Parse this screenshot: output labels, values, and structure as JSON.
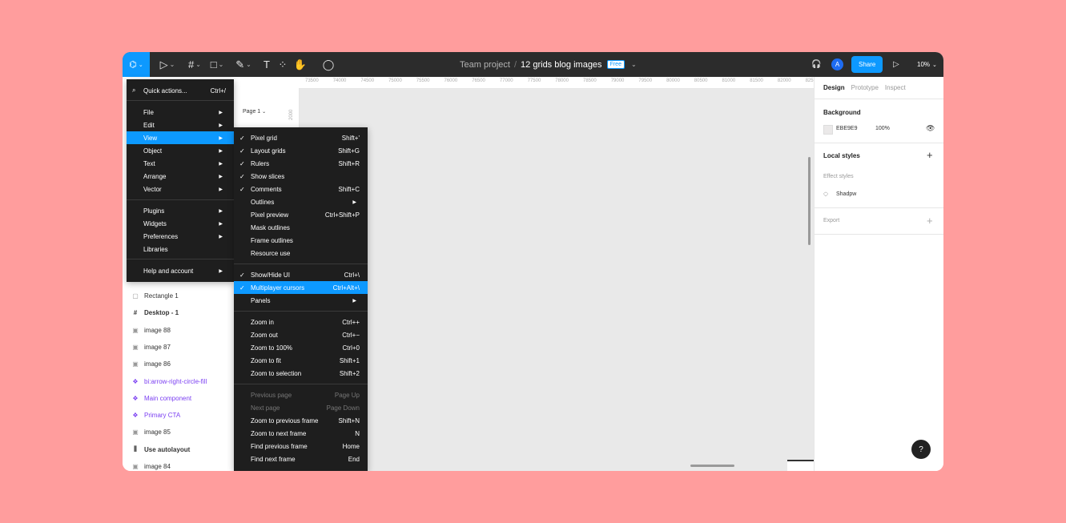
{
  "toolbar": {
    "logo_glyph": "⌬",
    "tools": [
      {
        "name": "move-tool-icon",
        "glyph": "▷"
      },
      {
        "name": "frame-tool-icon",
        "glyph": "#"
      },
      {
        "name": "shape-tool-icon",
        "glyph": "□"
      },
      {
        "name": "pen-tool-icon",
        "glyph": "✎"
      },
      {
        "name": "text-tool-icon",
        "glyph": "T"
      },
      {
        "name": "resources-icon",
        "glyph": "⁘"
      },
      {
        "name": "hand-tool-icon",
        "glyph": "✋"
      },
      {
        "name": "comment-tool-icon",
        "glyph": "◯"
      }
    ],
    "team": "Team project",
    "separator": "/",
    "file_name": "12 grids blog images",
    "badge": "Free",
    "avatar_letter": "A",
    "share_label": "Share",
    "zoom": "10%",
    "headphones_glyph": "🎧",
    "play_glyph": "▷"
  },
  "layers": {
    "page_label": "Page 1",
    "items": [
      {
        "label": "Rectangle 1",
        "kind": "rect",
        "icon": "▢"
      },
      {
        "label": "Desktop - 1",
        "kind": "frame",
        "icon": "#"
      },
      {
        "label": "image 88",
        "kind": "image",
        "icon": "▣"
      },
      {
        "label": "image 87",
        "kind": "image",
        "icon": "▣"
      },
      {
        "label": "image 86",
        "kind": "image",
        "icon": "▣"
      },
      {
        "label": "bi:arrow-right-circle-fill",
        "kind": "component",
        "icon": "❖"
      },
      {
        "label": "Main component",
        "kind": "component",
        "icon": "❖"
      },
      {
        "label": "Primary CTA",
        "kind": "component",
        "icon": "❖"
      },
      {
        "label": "image 85",
        "kind": "image",
        "icon": "▣"
      },
      {
        "label": "Use autolayout",
        "kind": "autolayout",
        "icon": "⫼"
      },
      {
        "label": "image 84",
        "kind": "image",
        "icon": "▣"
      }
    ]
  },
  "ruler": {
    "ticks": [
      "73500",
      "74000",
      "74500",
      "75000",
      "75500",
      "76000",
      "76500",
      "77000",
      "77500",
      "78000",
      "78500",
      "79000",
      "79500",
      "80000",
      "80500",
      "81000",
      "81500",
      "82000",
      "825"
    ],
    "left_ticks": [
      "2000",
      "1500"
    ]
  },
  "main_menu": {
    "quick_actions": "Quick actions...",
    "quick_actions_shortcut": "Ctrl+/",
    "items": [
      {
        "label": "File",
        "submenu": true
      },
      {
        "label": "Edit",
        "submenu": true
      },
      {
        "label": "View",
        "submenu": true,
        "selected": true
      },
      {
        "label": "Object",
        "submenu": true
      },
      {
        "label": "Text",
        "submenu": true
      },
      {
        "label": "Arrange",
        "submenu": true
      },
      {
        "label": "Vector",
        "submenu": true
      },
      {
        "label": "Plugins",
        "submenu": true
      },
      {
        "label": "Widgets",
        "submenu": true
      },
      {
        "label": "Preferences",
        "submenu": true
      },
      {
        "label": "Libraries",
        "submenu": false
      },
      {
        "label": "Help and account",
        "submenu": true
      }
    ]
  },
  "view_menu": {
    "items": [
      {
        "label": "Pixel grid",
        "shortcut": "Shift+'",
        "checked": true
      },
      {
        "label": "Layout grids",
        "shortcut": "Shift+G",
        "checked": true
      },
      {
        "label": "Rulers",
        "shortcut": "Shift+R",
        "checked": true
      },
      {
        "label": "Show slices",
        "shortcut": "",
        "checked": true
      },
      {
        "label": "Comments",
        "shortcut": "Shift+C",
        "checked": true
      },
      {
        "label": "Outlines",
        "shortcut": "",
        "submenu": true
      },
      {
        "label": "Pixel preview",
        "shortcut": "Ctrl+Shift+P"
      },
      {
        "label": "Mask outlines",
        "shortcut": ""
      },
      {
        "label": "Frame outlines",
        "shortcut": ""
      },
      {
        "label": "Resource use",
        "shortcut": ""
      },
      {
        "label": "Show/Hide UI",
        "shortcut": "Ctrl+\\",
        "checked": true
      },
      {
        "label": "Multiplayer cursors",
        "shortcut": "Ctrl+Alt+\\",
        "checked": true,
        "selected": true
      },
      {
        "label": "Panels",
        "shortcut": "",
        "submenu": true
      },
      {
        "label": "Zoom in",
        "shortcut": "Ctrl++"
      },
      {
        "label": "Zoom out",
        "shortcut": "Ctrl+−"
      },
      {
        "label": "Zoom to 100%",
        "shortcut": "Ctrl+0"
      },
      {
        "label": "Zoom to fit",
        "shortcut": "Shift+1"
      },
      {
        "label": "Zoom to selection",
        "shortcut": "Shift+2"
      },
      {
        "label": "Previous page",
        "shortcut": "Page Up",
        "disabled": true
      },
      {
        "label": "Next page",
        "shortcut": "Page Down",
        "disabled": true
      },
      {
        "label": "Zoom to previous frame",
        "shortcut": "Shift+N"
      },
      {
        "label": "Zoom to next frame",
        "shortcut": "N"
      },
      {
        "label": "Find previous frame",
        "shortcut": "Home"
      },
      {
        "label": "Find next frame",
        "shortcut": "End"
      }
    ]
  },
  "right_panel": {
    "tabs": [
      "Design",
      "Prototype",
      "Inspect"
    ],
    "background_label": "Background",
    "background_hex": "EBE9E9",
    "background_opacity": "100%",
    "local_styles_label": "Local styles",
    "effect_styles_label": "Effect styles",
    "effect_style_name": "Shadpw",
    "export_label": "Export",
    "help_glyph": "?"
  },
  "colors": {
    "accent": "#0d99ff",
    "toolbar_bg": "#2c2c2c",
    "menu_bg": "#1e1e1e",
    "page_bg": "#ff9d9d",
    "canvas_bg": "#e9e9e9",
    "component": "#7b3ff2"
  }
}
